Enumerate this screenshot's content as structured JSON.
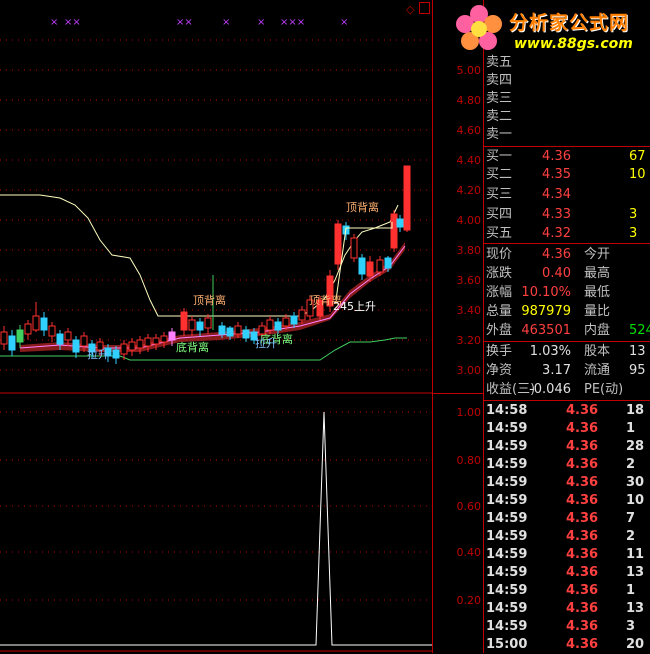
{
  "price_axis": [
    "5.00",
    "4.80",
    "4.60",
    "4.40",
    "4.20",
    "4.00",
    "3.80",
    "3.60",
    "3.40",
    "3.20",
    "3.00"
  ],
  "indicator_axis": [
    "1.00",
    "0.80",
    "0.60",
    "0.40",
    "0.20"
  ],
  "annotations": {
    "top_div_1": "顶背离",
    "top_div_2": "顶背离",
    "top_div_3": "顶背离",
    "bottom_div_1": "底背离",
    "bottom_div_2": "底背离",
    "lift_1": "拉升",
    "lift_2": "拉升",
    "rise_label": "245上升"
  },
  "top_marks": [
    "×",
    "××",
    "××",
    "×",
    "×",
    "×××",
    "×"
  ],
  "logo": {
    "title": "分析家公式网",
    "url": "www.88gs.com"
  },
  "order_book": [
    {
      "label": "卖五",
      "price": "",
      "vol": ""
    },
    {
      "label": "卖四",
      "price": "",
      "vol": ""
    },
    {
      "label": "卖三",
      "price": "",
      "vol": ""
    },
    {
      "label": "卖二",
      "price": "",
      "vol": ""
    },
    {
      "label": "卖一",
      "price": "",
      "vol": ""
    },
    {
      "label": "买一",
      "price": "4.36",
      "vol": "67"
    },
    {
      "label": "买二",
      "price": "4.35",
      "vol": "10"
    },
    {
      "label": "买三",
      "price": "4.34",
      "vol": ""
    },
    {
      "label": "买四",
      "price": "4.33",
      "vol": "3"
    },
    {
      "label": "买五",
      "price": "4.32",
      "vol": "3"
    }
  ],
  "quote": [
    {
      "k1": "现价",
      "v1": "4.36",
      "c1": "red",
      "k2": "今开",
      "v2": "",
      "c2": "red"
    },
    {
      "k1": "涨跌",
      "v1": "0.40",
      "c1": "red",
      "k2": "最高",
      "v2": "",
      "c2": "red"
    },
    {
      "k1": "涨幅",
      "v1": "10.10%",
      "c1": "red",
      "k2": "最低",
      "v2": "",
      "c2": "red"
    },
    {
      "k1": "总量",
      "v1": "987979",
      "c1": "yellow",
      "k2": "量比",
      "v2": "",
      "c2": "white"
    },
    {
      "k1": "外盘",
      "v1": "463501",
      "c1": "red",
      "k2": "内盘",
      "v2": "524",
      "c2": "green"
    },
    {
      "k1": "换手",
      "v1": "1.03%",
      "c1": "white",
      "k2": "股本",
      "v2": "13",
      "c2": "white"
    },
    {
      "k1": "净资",
      "v1": "3.17",
      "c1": "white",
      "k2": "流通",
      "v2": "95",
      "c2": "white"
    },
    {
      "k1": "收益(三)",
      "v1": "-0.046",
      "c1": "white",
      "k2": "PE(动)",
      "v2": "",
      "c2": "white"
    }
  ],
  "ticks": [
    {
      "time": "14:58",
      "price": "4.36",
      "vol": "18"
    },
    {
      "time": "14:59",
      "price": "4.36",
      "vol": "1"
    },
    {
      "time": "14:59",
      "price": "4.36",
      "vol": "28"
    },
    {
      "time": "14:59",
      "price": "4.36",
      "vol": "2"
    },
    {
      "time": "14:59",
      "price": "4.36",
      "vol": "30"
    },
    {
      "time": "14:59",
      "price": "4.36",
      "vol": "10"
    },
    {
      "time": "14:59",
      "price": "4.36",
      "vol": "7"
    },
    {
      "time": "14:59",
      "price": "4.36",
      "vol": "2"
    },
    {
      "time": "14:59",
      "price": "4.36",
      "vol": "11"
    },
    {
      "time": "14:59",
      "price": "4.36",
      "vol": "13"
    },
    {
      "time": "14:59",
      "price": "4.36",
      "vol": "1"
    },
    {
      "time": "14:59",
      "price": "4.36",
      "vol": "13"
    },
    {
      "time": "14:59",
      "price": "4.36",
      "vol": "3"
    },
    {
      "time": "15:00",
      "price": "4.36",
      "vol": "20"
    }
  ],
  "colors": {
    "up": "#ff3030",
    "down": "#30d0ff",
    "grid": "#c00000",
    "line": "#ffffc0"
  }
}
